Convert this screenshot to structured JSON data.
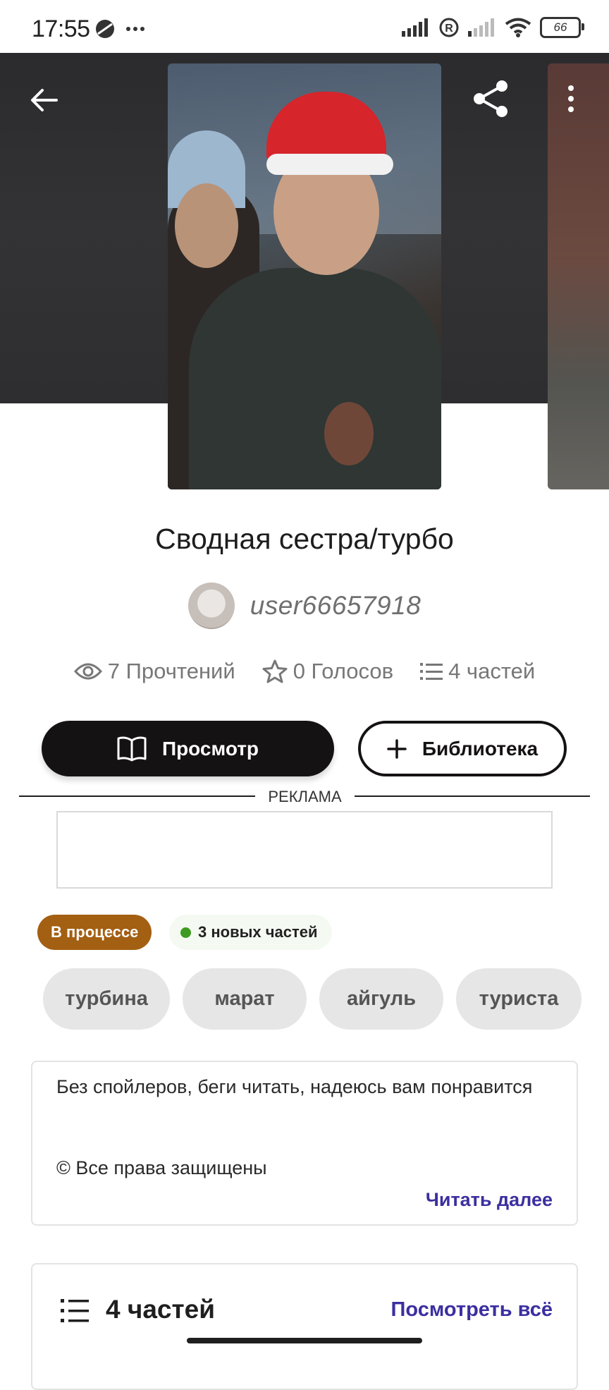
{
  "status_bar": {
    "time": "17:55",
    "battery": "66",
    "icons": [
      "do-not-disturb-icon",
      "more-dots-icon",
      "signal-icon",
      "roaming-r-icon",
      "signal-weak-icon",
      "wifi-icon",
      "battery-icon"
    ]
  },
  "header": {
    "icons": [
      "back-arrow-icon",
      "share-icon",
      "more-vertical-icon"
    ]
  },
  "story": {
    "title": "Сводная сестра/турбо",
    "author": "user66657918",
    "stats": {
      "reads": "7 Прочтений",
      "votes": "0 Голосов",
      "parts": "4 частей"
    }
  },
  "actions": {
    "read_label": "Просмотр",
    "library_label": "Библиотека"
  },
  "ad": {
    "label": "РЕКЛАМА"
  },
  "badges": {
    "status": "В процессе",
    "new_parts": "3 новых частей",
    "new_parts_dot_color": "#3d9b22",
    "status_color": "#a35f12"
  },
  "tags": [
    "турбина",
    "марат",
    "айгуль",
    "туриста"
  ],
  "description": {
    "text": "Без спойлеров, беги читать, надеюсь вам понравится",
    "copyright": "© Все права защищены",
    "read_more": "Читать далее"
  },
  "parts_section": {
    "title": "4 частей",
    "view_all": "Посмотреть всё"
  },
  "colors": {
    "accent_link": "#3b2fa0",
    "primary_button": "#151213"
  }
}
